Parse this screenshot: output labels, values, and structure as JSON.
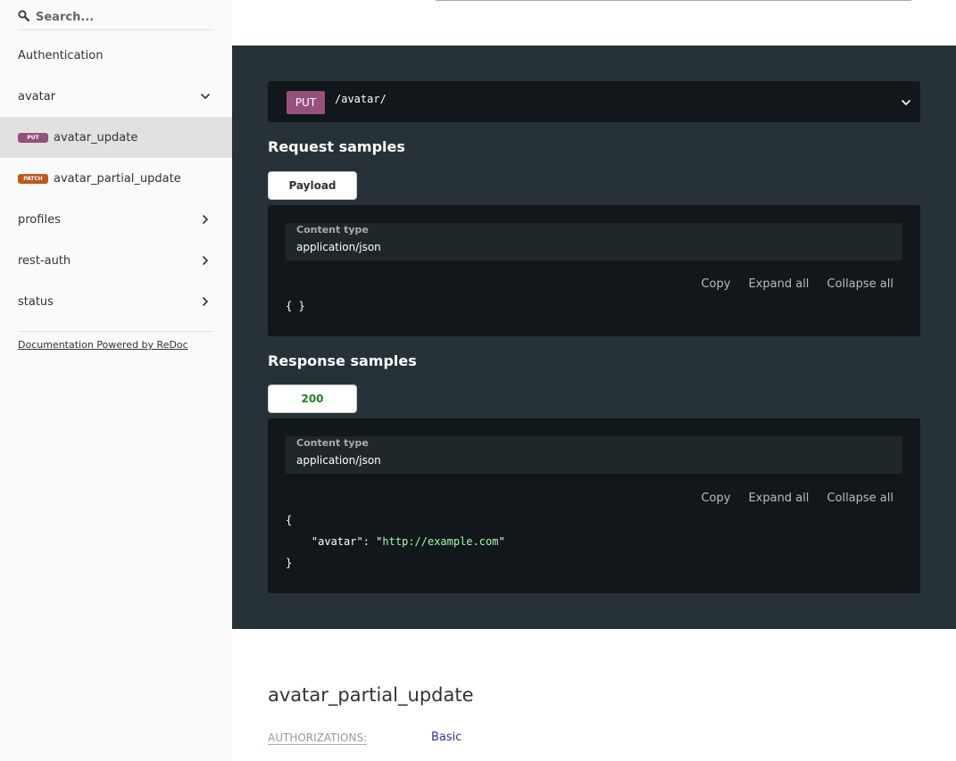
{
  "sidebar": {
    "search_placeholder": "Search...",
    "items": [
      {
        "label": "Authentication"
      },
      {
        "label": "avatar"
      },
      {
        "badge": "PUT",
        "label": "avatar_update"
      },
      {
        "badge": "PATCH",
        "label": "avatar_partial_update"
      },
      {
        "label": "profiles"
      },
      {
        "label": "rest-auth"
      },
      {
        "label": "status"
      }
    ],
    "powered_by": "Documentation Powered by ReDoc"
  },
  "endpoint": {
    "method": "PUT",
    "path": "/avatar/"
  },
  "request": {
    "title": "Request samples",
    "tab": "Payload",
    "content_type_label": "Content type",
    "content_type": "application/json",
    "actions": [
      "Copy",
      "Expand all",
      "Collapse all"
    ],
    "body": "{ }"
  },
  "response": {
    "title": "Response samples",
    "tab": "200",
    "content_type_label": "Content type",
    "content_type": "application/json",
    "actions": [
      "Copy",
      "Expand all",
      "Collapse all"
    ],
    "open_brace": "{",
    "key": "\"avatar\"",
    "colon": ": ",
    "quote": "\"",
    "value": "http://example.com",
    "close_brace": "}"
  },
  "operation": {
    "title": "avatar_partial_update",
    "auth_label": "AUTHORIZATIONS:",
    "auth_value": "Basic"
  },
  "colors": {
    "put": "#95507c",
    "patch": "#bf581d",
    "dark_panel": "#263238",
    "success": "#1d8127"
  }
}
